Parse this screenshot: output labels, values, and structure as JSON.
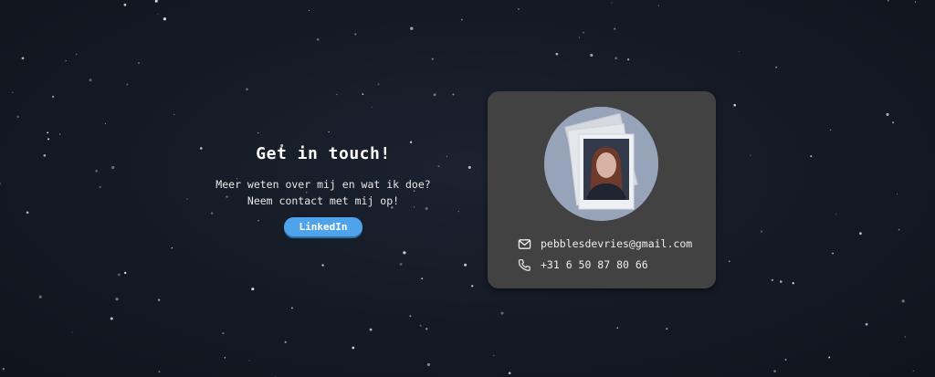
{
  "contact_section": {
    "heading": "Get in touch!",
    "intro_line_1": "Meer weten over mij en wat ik doe?",
    "intro_line_2": "Neem contact met mij op!",
    "linkedin_label": "LinkedIn"
  },
  "card": {
    "avatar_icon": "profile-photo",
    "email": "pebblesdevries@gmail.com",
    "email_icon": "mail-icon",
    "phone": "+31 6 50 87 80 66",
    "phone_icon": "phone-icon"
  },
  "colors": {
    "background": "#141a24",
    "card": "#424242",
    "button": "#4fa3ea"
  }
}
